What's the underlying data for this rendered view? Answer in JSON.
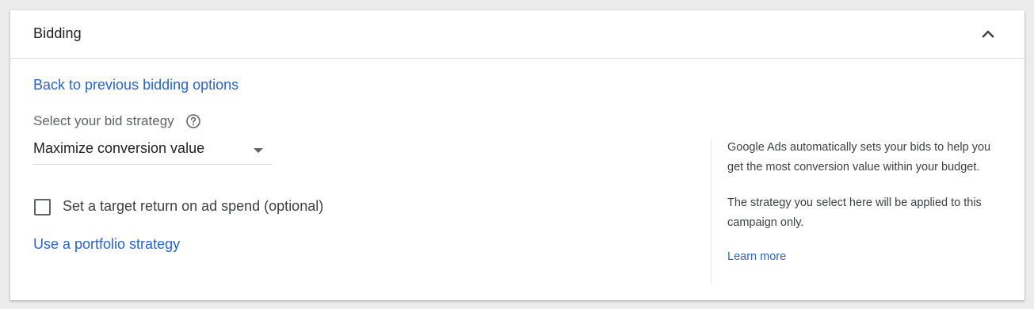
{
  "section": {
    "title": "Bidding",
    "collapse_icon": "chevron-up-icon"
  },
  "main": {
    "back_link": "Back to previous bidding options",
    "strategy_label": "Select your bid strategy",
    "help_icon": "help-circle-icon",
    "strategy_select": {
      "selected": "Maximize conversion value",
      "arrow_icon": "dropdown-arrow-icon"
    },
    "target_roas_checkbox": {
      "label": "Set a target return on ad spend (optional)",
      "checked": false
    },
    "portfolio_link": "Use a portfolio strategy"
  },
  "info_panel": {
    "paragraph_1": "Google Ads automatically sets your bids to help you get the most conversion value within your budget.",
    "paragraph_2": "The strategy you select here will be applied to this campaign only.",
    "learn_more": "Learn more"
  },
  "colors": {
    "link": "#2a64c6",
    "text_primary": "#202124",
    "text_secondary": "#5f6368",
    "divider": "#dadce0",
    "background": "#ececec"
  }
}
